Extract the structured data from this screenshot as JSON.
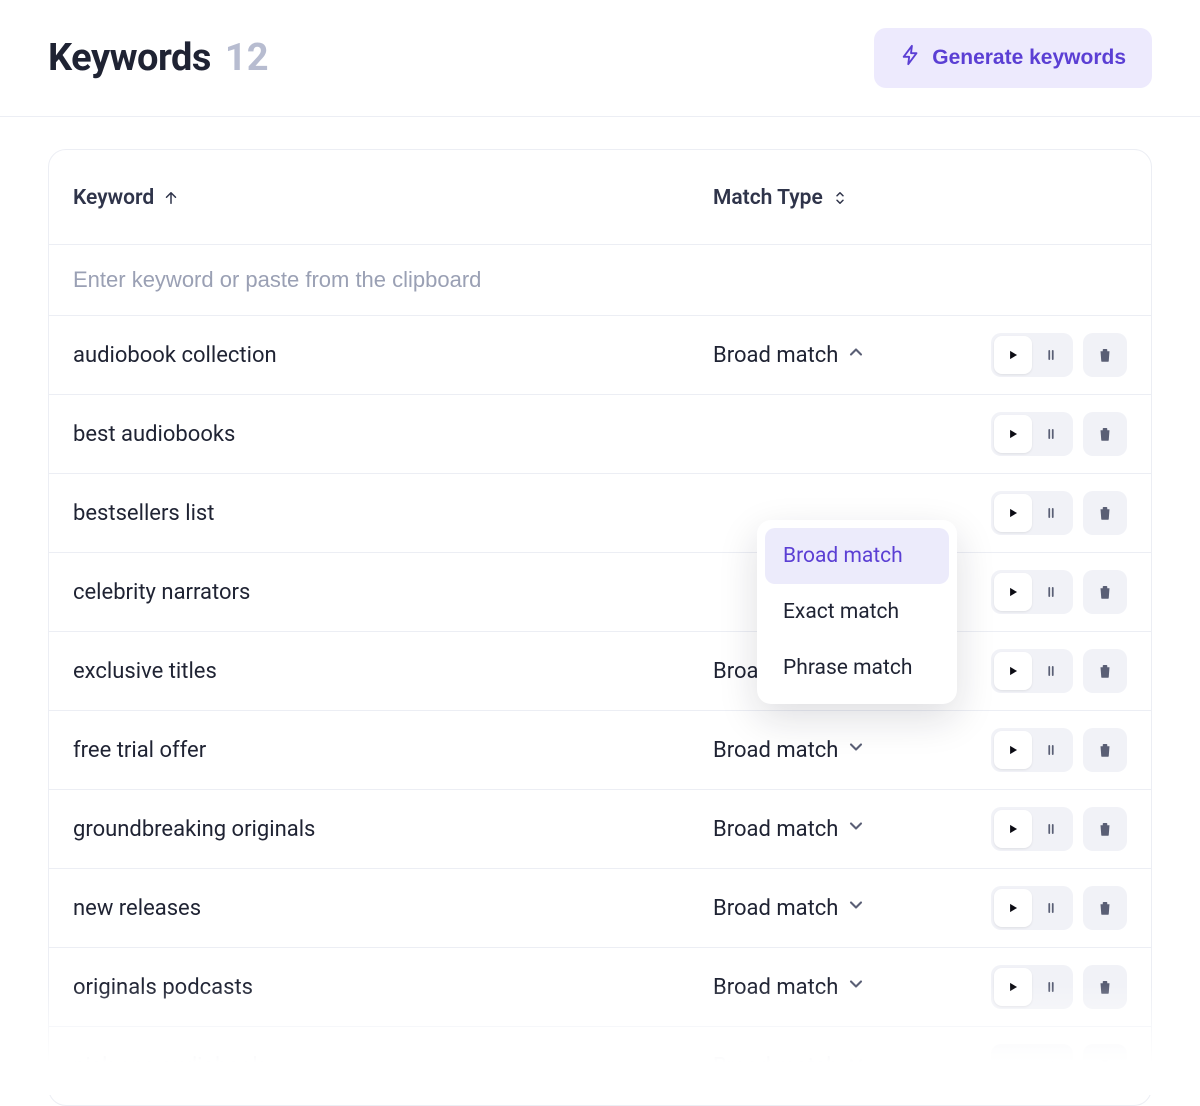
{
  "header": {
    "title": "Keywords",
    "count": "12",
    "generate_label": "Generate keywords"
  },
  "columns": {
    "keyword": "Keyword",
    "match_type": "Match Type"
  },
  "input": {
    "placeholder": "Enter keyword or paste from the clipboard"
  },
  "match_type_default": "Broad match",
  "dropdown": {
    "options": [
      "Broad match",
      "Exact match",
      "Phrase match"
    ],
    "selected": "Broad match"
  },
  "rows": [
    {
      "keyword": "audiobook collection",
      "match": "Broad match",
      "open": true,
      "faded": false
    },
    {
      "keyword": "best audiobooks",
      "match": "",
      "open": false,
      "faded": false
    },
    {
      "keyword": "bestsellers list",
      "match": "",
      "open": false,
      "faded": false
    },
    {
      "keyword": "celebrity narrators",
      "match": "",
      "open": false,
      "faded": false
    },
    {
      "keyword": "exclusive titles",
      "match": "Broad match",
      "open": false,
      "faded": false
    },
    {
      "keyword": "free trial offer",
      "match": "Broad match",
      "open": false,
      "faded": false
    },
    {
      "keyword": "groundbreaking originals",
      "match": "Broad match",
      "open": false,
      "faded": false
    },
    {
      "keyword": "new releases",
      "match": "Broad match",
      "open": false,
      "faded": false
    },
    {
      "keyword": "originals podcasts",
      "match": "Broad match",
      "open": false,
      "faded": false
    },
    {
      "keyword": "pick one audiobook",
      "match": "Broad match",
      "open": false,
      "faded": true
    }
  ],
  "icons": {
    "lightning": "lightning-icon",
    "arrow_up": "arrow-up-icon",
    "sort_both": "sort-both-icon",
    "chevron_up": "chevron-up-icon",
    "chevron_down": "chevron-down-icon",
    "play": "play-icon",
    "pause": "pause-icon",
    "trash": "trash-icon"
  }
}
